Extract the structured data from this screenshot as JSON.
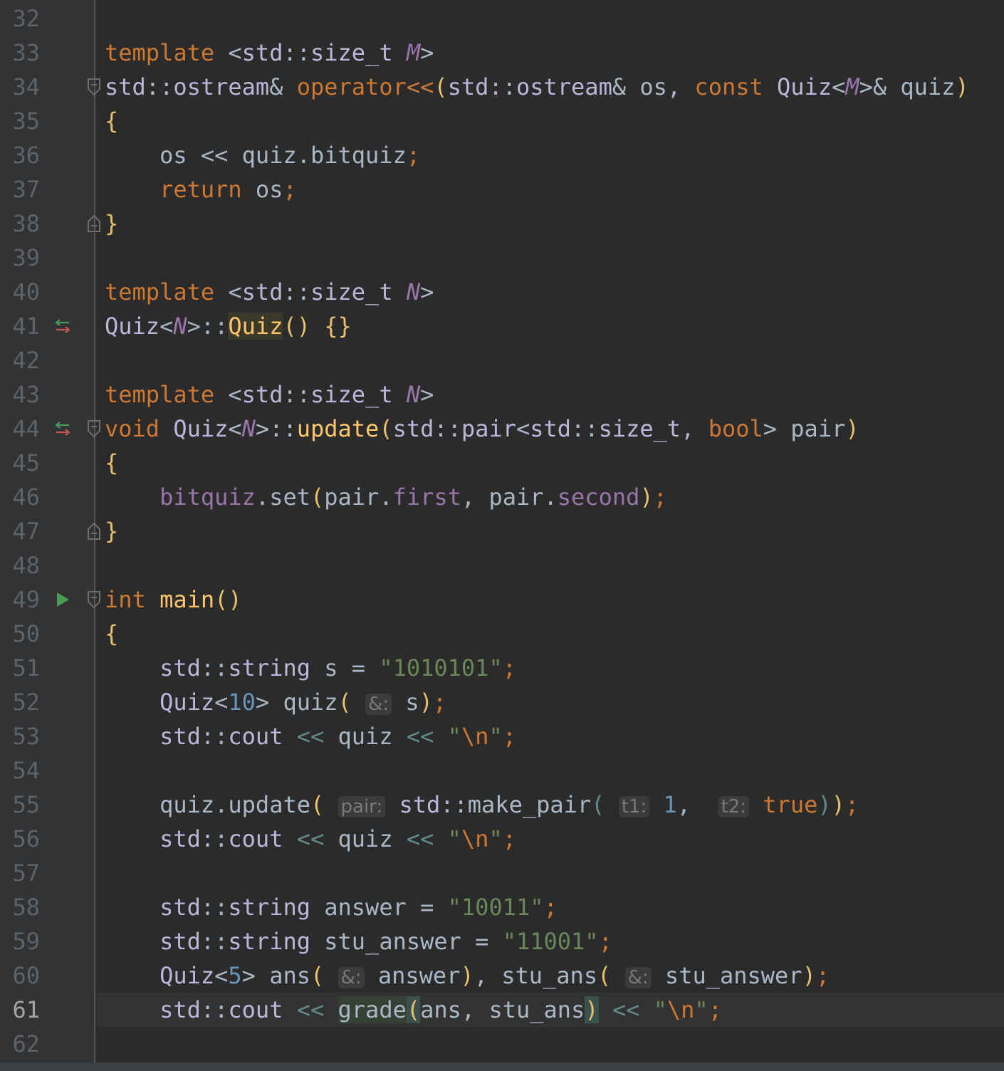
{
  "editor": {
    "current_line": "61",
    "lines": [
      {
        "n": "32",
        "text": ""
      },
      {
        "n": "33",
        "text": "template <std::size_t M>"
      },
      {
        "n": "34",
        "text": "std::ostream& operator<<(std::ostream& os, const Quiz<M>& quiz)"
      },
      {
        "n": "35",
        "text": "{"
      },
      {
        "n": "36",
        "text": "    os << quiz.bitquiz;"
      },
      {
        "n": "37",
        "text": "    return os;"
      },
      {
        "n": "38",
        "text": "}"
      },
      {
        "n": "39",
        "text": ""
      },
      {
        "n": "40",
        "text": "template <std::size_t N>"
      },
      {
        "n": "41",
        "text": "Quiz<N>::Quiz() {}"
      },
      {
        "n": "42",
        "text": ""
      },
      {
        "n": "43",
        "text": "template <std::size_t N>"
      },
      {
        "n": "44",
        "text": "void Quiz<N>::update(std::pair<std::size_t, bool> pair)"
      },
      {
        "n": "45",
        "text": "{"
      },
      {
        "n": "46",
        "text": "    bitquiz.set(pair.first, pair.second);"
      },
      {
        "n": "47",
        "text": "}"
      },
      {
        "n": "48",
        "text": ""
      },
      {
        "n": "49",
        "text": "int main()"
      },
      {
        "n": "50",
        "text": "{"
      },
      {
        "n": "51",
        "text": "    std::string s = \"1010101\";"
      },
      {
        "n": "52",
        "text": "    Quiz<10> quiz(&: s);"
      },
      {
        "n": "53",
        "text": "    std::cout << quiz << \"\\n\";"
      },
      {
        "n": "54",
        "text": ""
      },
      {
        "n": "55",
        "text": "    quiz.update(pair: std::make_pair(t1: 1, t2: true));"
      },
      {
        "n": "56",
        "text": "    std::cout << quiz << \"\\n\";"
      },
      {
        "n": "57",
        "text": ""
      },
      {
        "n": "58",
        "text": "    std::string answer = \"10011\";"
      },
      {
        "n": "59",
        "text": "    std::string stu_answer = \"11001\";"
      },
      {
        "n": "60",
        "text": "    Quiz<5> ans(&: answer), stu_ans(&: stu_answer);"
      },
      {
        "n": "61",
        "text": "    std::cout << grade(ans, stu_ans) << \"\\n\";"
      },
      {
        "n": "62",
        "text": ""
      }
    ]
  },
  "gutter_icons": {
    "41": "implements-icon",
    "44": "implements-icon",
    "49": "run-icon"
  },
  "fold_markers": {
    "34": "fold-open-icon",
    "38": "fold-close-icon",
    "44": "fold-open-icon",
    "47": "fold-close-icon",
    "49": "fold-open-icon"
  },
  "colors": {
    "background": "#2b2b2b",
    "gutter": "#313335",
    "keyword": "#cc7832",
    "type": "#b9b7da",
    "template_param": "#9876aa",
    "function": "#ffc66d",
    "string": "#6a8759",
    "number": "#6897bb",
    "current_line": "#323232"
  }
}
